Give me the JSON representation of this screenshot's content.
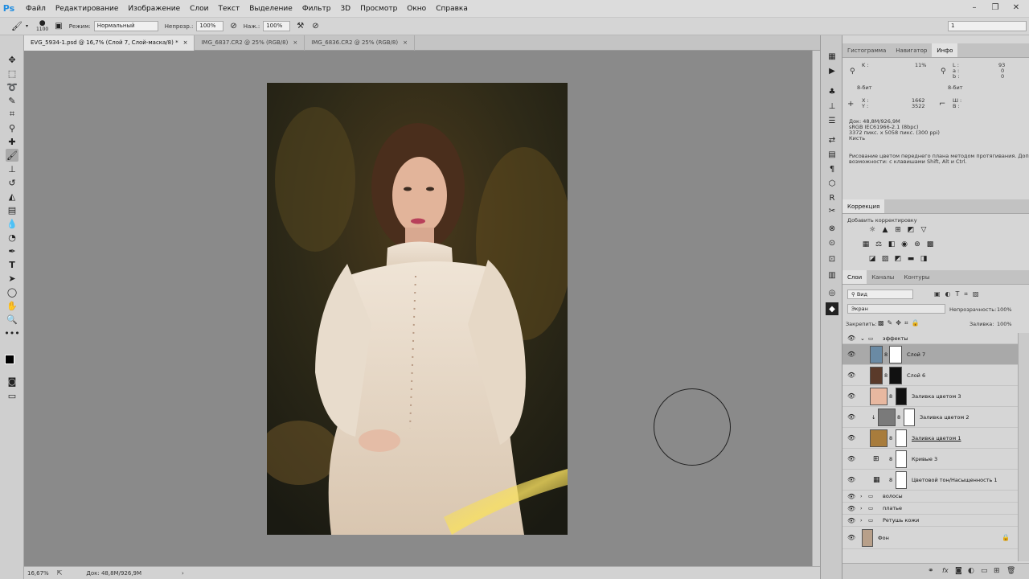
{
  "app": {
    "logo": "Ps"
  },
  "menu": [
    "Файл",
    "Редактирование",
    "Изображение",
    "Слои",
    "Текст",
    "Выделение",
    "Фильтр",
    "3D",
    "Просмотр",
    "Окно",
    "Справка"
  ],
  "window_controls": [
    "–",
    "❐",
    "✕"
  ],
  "options": {
    "brush_size": "1100",
    "mode_label": "Режим:",
    "mode_value": "Нормальный",
    "opacity_label": "Непрозр.:",
    "opacity_value": "100%",
    "pressure_label": "Наж.:",
    "pressure_value": "100%",
    "workspace_value": "1"
  },
  "tabs": [
    {
      "label": "EVG_5934-1.psd @ 16,7% (Слой 7, Слой-маска/8) *",
      "active": true
    },
    {
      "label": "IMG_6837.CR2 @ 25% (RGB/8)",
      "active": false
    },
    {
      "label": "IMG_6836.CR2 @ 25% (RGB/8)",
      "active": false
    }
  ],
  "status": {
    "zoom": "16,67%",
    "doc": "Док: 48,8M/926,9M"
  },
  "info_panel": {
    "tabs": [
      "Гистограмма",
      "Навигатор",
      "Инфо"
    ],
    "active_tab": "Инфо",
    "k_label": "K :",
    "k_value": "11%",
    "l_label": "L :",
    "l_value": "93",
    "a_label": "a :",
    "a_value": "0",
    "b_label": "b :",
    "b_value": "0",
    "bit_left": "8-бит",
    "bit_right": "8-бит",
    "x_label": "X :",
    "x_value": "1662",
    "y_label": "Y :",
    "y_value": "3522",
    "w_label": "Ш :",
    "h_label": "В :",
    "doc_line": "Док: 48,8M/926,9M",
    "profile_line": "sRGB IEC61966-2.1 (8bpc)",
    "size_line": "3372 пикс. x 5058 пикс. (300 ppi)",
    "tool_line": "Кисть",
    "hint_line1": "Рисование цветом переднего плана методом протягивания. Доп.",
    "hint_line2": "возможности: с клавишами Shift, Alt и Ctrl."
  },
  "correction_panel": {
    "tab": "Коррекция",
    "heading": "Добавить корректировку"
  },
  "layers_panel": {
    "tabs": [
      "Слои",
      "Каналы",
      "Контуры"
    ],
    "filter_value": "Вид",
    "blend_value": "Экран",
    "opacity_label": "Непрозрачность:",
    "opacity_value": "100%",
    "lock_label": "Закрепить:",
    "fill_label": "Заливка:",
    "fill_value": "100%",
    "layers": [
      {
        "name": "эффекты",
        "kind": "group-open"
      },
      {
        "name": "Слой 7",
        "kind": "layer-mask",
        "selected": true
      },
      {
        "name": "Слой 6",
        "kind": "layer-mask"
      },
      {
        "name": "Заливка цветом 3",
        "kind": "fill",
        "color": "#e8b8a0"
      },
      {
        "name": "Заливка цветом 2",
        "kind": "fill",
        "color": "#7a7a7a"
      },
      {
        "name": "Заливка цветом 1",
        "kind": "fill",
        "color": "#a87c3c"
      },
      {
        "name": "Кривые 3",
        "kind": "adjust"
      },
      {
        "name": "Цветовой тон/Насыщенность 1",
        "kind": "adjust"
      },
      {
        "name": "волосы",
        "kind": "group"
      },
      {
        "name": "платье",
        "kind": "group"
      },
      {
        "name": "Ретушь кожи",
        "kind": "group"
      },
      {
        "name": "Фон",
        "kind": "background"
      }
    ]
  }
}
